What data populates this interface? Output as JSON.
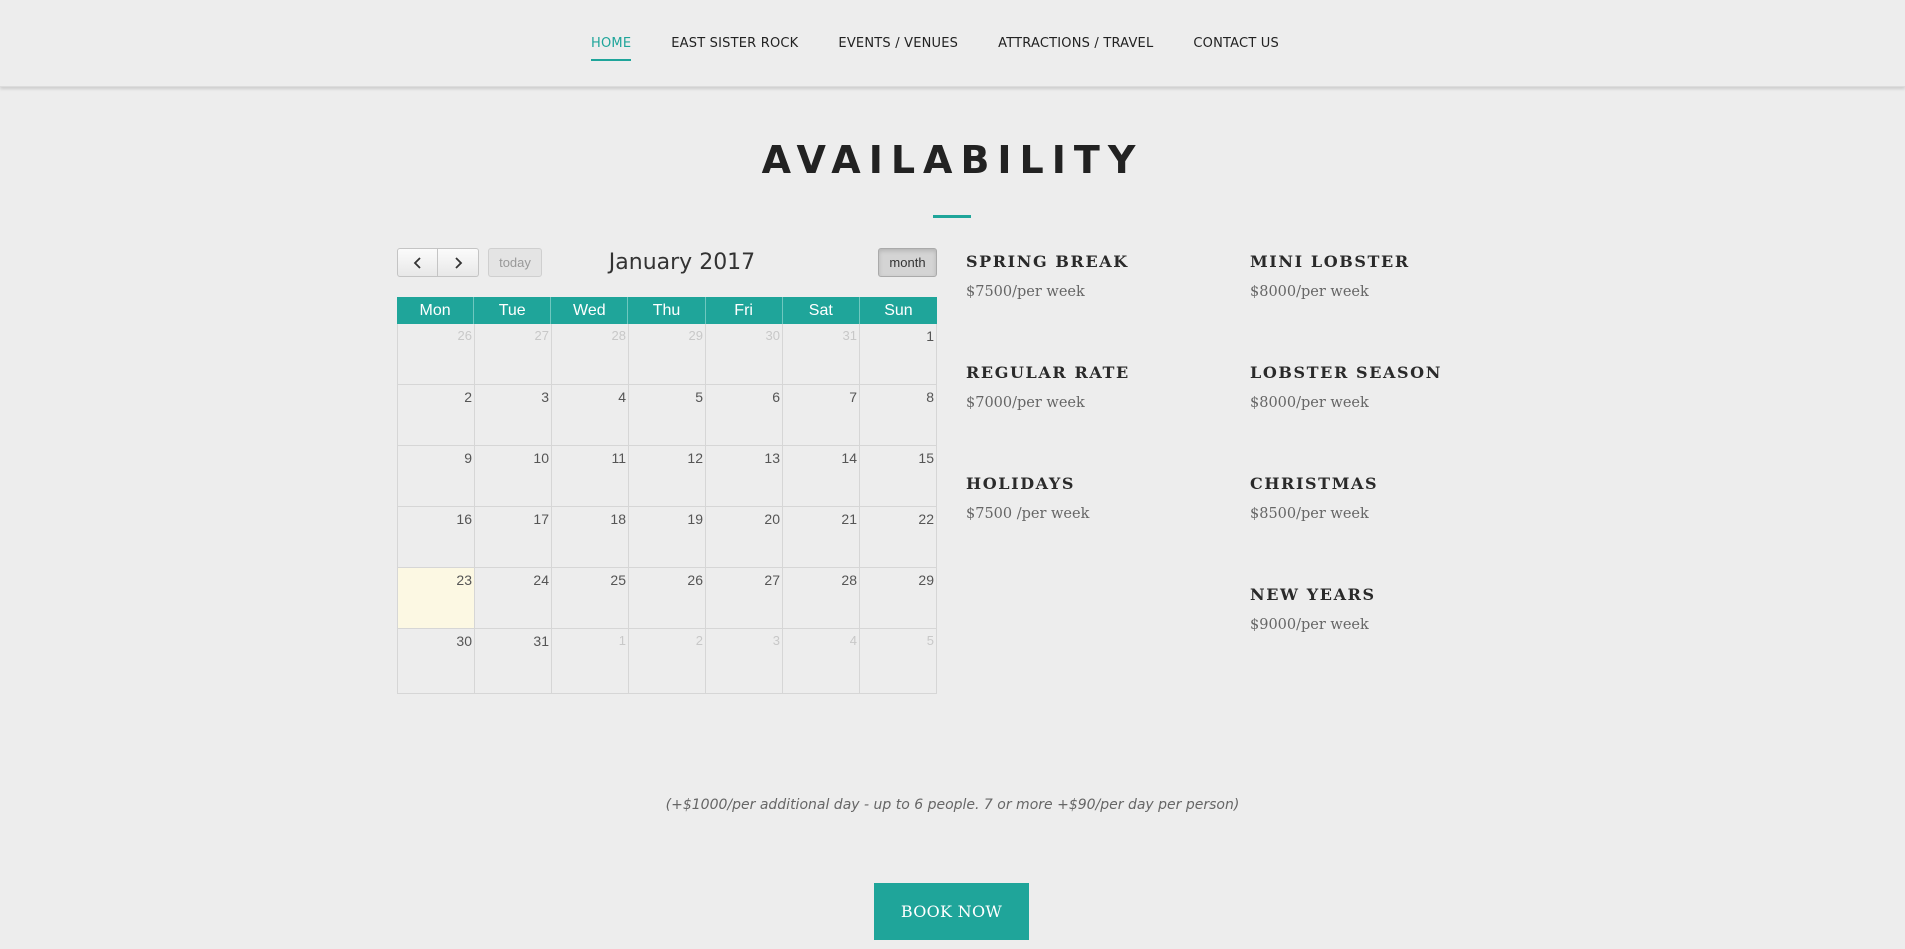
{
  "nav": {
    "items": [
      {
        "label": "HOME",
        "active": true
      },
      {
        "label": "EAST SISTER ROCK",
        "active": false
      },
      {
        "label": "EVENTS / VENUES",
        "active": false
      },
      {
        "label": "ATTRACTIONS / TRAVEL",
        "active": false
      },
      {
        "label": "CONTACT US",
        "active": false
      }
    ]
  },
  "page_title": "AVAILABILITY",
  "calendar": {
    "today_label": "today",
    "title": "January 2017",
    "view_label": "month",
    "prev_icon": "chevron-left-icon",
    "next_icon": "chevron-right-icon",
    "weekdays": [
      "Mon",
      "Tue",
      "Wed",
      "Thu",
      "Fri",
      "Sat",
      "Sun"
    ],
    "weeks": [
      [
        {
          "day": "26",
          "other": true
        },
        {
          "day": "27",
          "other": true
        },
        {
          "day": "28",
          "other": true
        },
        {
          "day": "29",
          "other": true
        },
        {
          "day": "30",
          "other": true
        },
        {
          "day": "31",
          "other": true
        },
        {
          "day": "1",
          "other": false
        }
      ],
      [
        {
          "day": "2",
          "other": false
        },
        {
          "day": "3",
          "other": false
        },
        {
          "day": "4",
          "other": false
        },
        {
          "day": "5",
          "other": false
        },
        {
          "day": "6",
          "other": false
        },
        {
          "day": "7",
          "other": false
        },
        {
          "day": "8",
          "other": false
        }
      ],
      [
        {
          "day": "9",
          "other": false
        },
        {
          "day": "10",
          "other": false
        },
        {
          "day": "11",
          "other": false
        },
        {
          "day": "12",
          "other": false
        },
        {
          "day": "13",
          "other": false
        },
        {
          "day": "14",
          "other": false
        },
        {
          "day": "15",
          "other": false
        }
      ],
      [
        {
          "day": "16",
          "other": false
        },
        {
          "day": "17",
          "other": false
        },
        {
          "day": "18",
          "other": false
        },
        {
          "day": "19",
          "other": false
        },
        {
          "day": "20",
          "other": false
        },
        {
          "day": "21",
          "other": false
        },
        {
          "day": "22",
          "other": false
        }
      ],
      [
        {
          "day": "23",
          "other": false,
          "today": true
        },
        {
          "day": "24",
          "other": false
        },
        {
          "day": "25",
          "other": false
        },
        {
          "day": "26",
          "other": false
        },
        {
          "day": "27",
          "other": false
        },
        {
          "day": "28",
          "other": false
        },
        {
          "day": "29",
          "other": false
        }
      ],
      [
        {
          "day": "30",
          "other": false
        },
        {
          "day": "31",
          "other": false
        },
        {
          "day": "1",
          "other": true
        },
        {
          "day": "2",
          "other": true
        },
        {
          "day": "3",
          "other": true
        },
        {
          "day": "4",
          "other": true
        },
        {
          "day": "5",
          "other": true
        }
      ]
    ]
  },
  "rates": [
    {
      "name": "SPRING BREAK",
      "price": "$7500/per week",
      "column": 0,
      "row": 0
    },
    {
      "name": "MINI LOBSTER",
      "price": "$8000/per week",
      "column": 1,
      "row": 0
    },
    {
      "name": "REGULAR RATE",
      "price": "$7000/per week",
      "column": 0,
      "row": 1
    },
    {
      "name": "LOBSTER SEASON",
      "price": "$8000/per week",
      "column": 1,
      "row": 1
    },
    {
      "name": "HOLIDAYS",
      "price": "$7500 /per week",
      "column": 0,
      "row": 2
    },
    {
      "name": "CHRISTMAS",
      "price": "$8500/per week",
      "column": 1,
      "row": 2
    },
    {
      "name": "NEW YEARS",
      "price": "$9000/per week",
      "column": 1,
      "row": 3
    }
  ],
  "note": "(+$1000/per additional day - up to 6 people. 7 or more +$90/per day per person)",
  "book_button": "BOOK NOW",
  "colors": {
    "accent": "#1fa59a",
    "today_highlight": "#fcf8e3"
  }
}
